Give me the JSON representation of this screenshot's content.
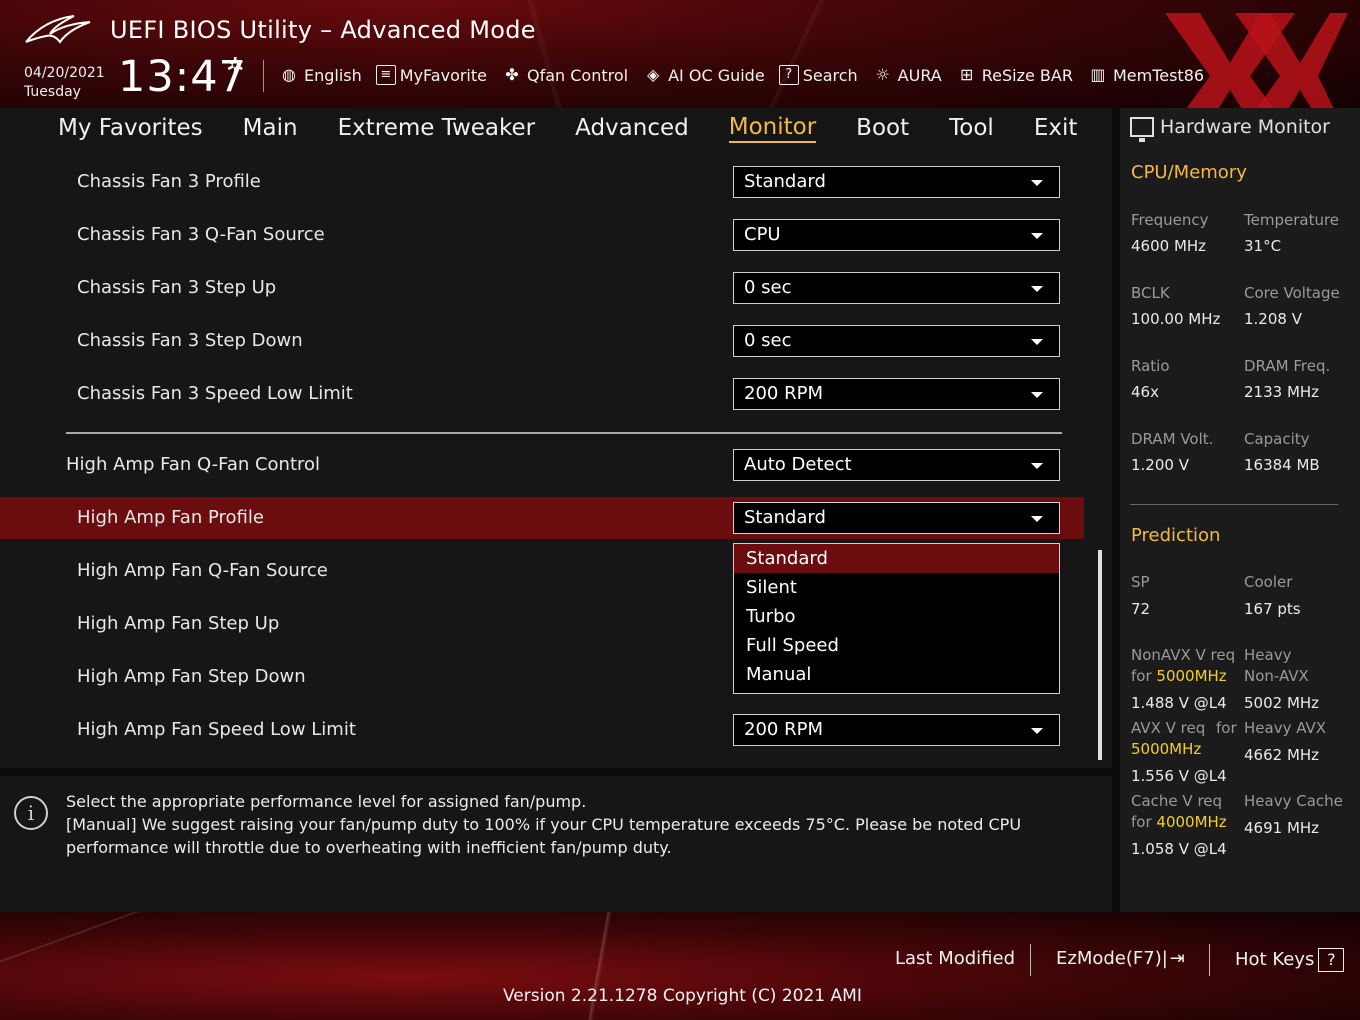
{
  "header": {
    "title": "UEFI BIOS Utility – Advanced Mode",
    "date": "04/20/2021",
    "day": "Tuesday",
    "time": "13:47",
    "toolbar": [
      {
        "label": "English",
        "icon": "globe-icon"
      },
      {
        "label": "MyFavorite",
        "icon": "favorite-list-icon"
      },
      {
        "label": "Qfan Control",
        "icon": "fan-icon"
      },
      {
        "label": "AI OC Guide",
        "icon": "ai-chip-icon"
      },
      {
        "label": "Search",
        "icon": "search-box-icon"
      },
      {
        "label": "AURA",
        "icon": "aura-light-icon"
      },
      {
        "label": "ReSize BAR",
        "icon": "resize-bar-icon"
      },
      {
        "label": "MemTest86",
        "icon": "memory-icon"
      }
    ]
  },
  "nav": {
    "tabs": [
      "My Favorites",
      "Main",
      "Extreme Tweaker",
      "Advanced",
      "Monitor",
      "Boot",
      "Tool",
      "Exit"
    ],
    "active": "Monitor"
  },
  "settings": [
    {
      "label": "Chassis Fan 3 Profile",
      "value": "Standard"
    },
    {
      "label": "Chassis Fan 3 Q-Fan Source",
      "value": "CPU"
    },
    {
      "label": "Chassis Fan 3 Step Up",
      "value": "0 sec"
    },
    {
      "label": "Chassis Fan 3 Step Down",
      "value": "0 sec"
    },
    {
      "label": "Chassis Fan 3 Speed Low Limit",
      "value": "200 RPM"
    },
    {
      "label": "High Amp Fan Q-Fan Control",
      "value": "Auto Detect"
    },
    {
      "label": "High Amp Fan Profile",
      "value": "Standard"
    },
    {
      "label": "High Amp Fan Q-Fan Source",
      "value": ""
    },
    {
      "label": "High Amp Fan Step Up",
      "value": ""
    },
    {
      "label": "High Amp Fan Step Down",
      "value": ""
    },
    {
      "label": "High Amp Fan Speed Low Limit",
      "value": "200 RPM"
    }
  ],
  "dropdown_open": {
    "options": [
      "Standard",
      "Silent",
      "Turbo",
      "Full Speed",
      "Manual"
    ],
    "selected": "Standard"
  },
  "help": {
    "line1": "Select the appropriate performance level for assigned fan/pump.",
    "line2": "[Manual] We suggest raising your fan/pump duty to 100% if your CPU temperature exceeds 75°C. Please be noted CPU performance will throttle due to overheating with inefficient fan/pump duty."
  },
  "hardware_monitor": {
    "title": "Hardware Monitor",
    "cpu_section": "CPU/Memory",
    "frequency_label": "Frequency",
    "frequency": "4600 MHz",
    "temperature_label": "Temperature",
    "temperature": "31°C",
    "bclk_label": "BCLK",
    "bclk": "100.00 MHz",
    "core_voltage_label": "Core Voltage",
    "core_voltage": "1.208 V",
    "ratio_label": "Ratio",
    "ratio": "46x",
    "dram_freq_label": "DRAM Freq.",
    "dram_freq": "2133 MHz",
    "dram_volt_label": "DRAM Volt.",
    "dram_volt": "1.200 V",
    "capacity_label": "Capacity",
    "capacity": "16384 MB",
    "prediction_section": "Prediction",
    "sp_label": "SP",
    "sp": "72",
    "cooler_label": "Cooler",
    "cooler": "167 pts",
    "nonavx_label": "NonAVX V req",
    "nonavx_for": "for",
    "nonavx_freq": "5000MHz",
    "nonavx_v": "1.488 V @L4",
    "heavy_nonavx_label1": "Heavy",
    "heavy_nonavx_label2": "Non-AVX",
    "heavy_nonavx": "5002 MHz",
    "avx_label": "AVX V req",
    "avx_for": "for",
    "avx_freq": "5000MHz",
    "avx_v": "1.556 V @L4",
    "heavy_avx_label": "Heavy AVX",
    "heavy_avx": "4662 MHz",
    "cache_label": "Cache V req",
    "cache_for": "for",
    "cache_freq": "4000MHz",
    "cache_v": "1.058 V @L4",
    "heavy_cache_label": "Heavy Cache",
    "heavy_cache": "4691 MHz"
  },
  "footer": {
    "last_modified": "Last Modified",
    "ezmode": "EzMode(F7)|",
    "hotkeys": "Hot Keys",
    "hotkeys_icon": "?",
    "version": "Version 2.21.1278 Copyright (C) 2021 AMI"
  },
  "colors": {
    "accent": "#f4b942",
    "selection": "#6b0d0f",
    "highlight": "#f4d020"
  }
}
